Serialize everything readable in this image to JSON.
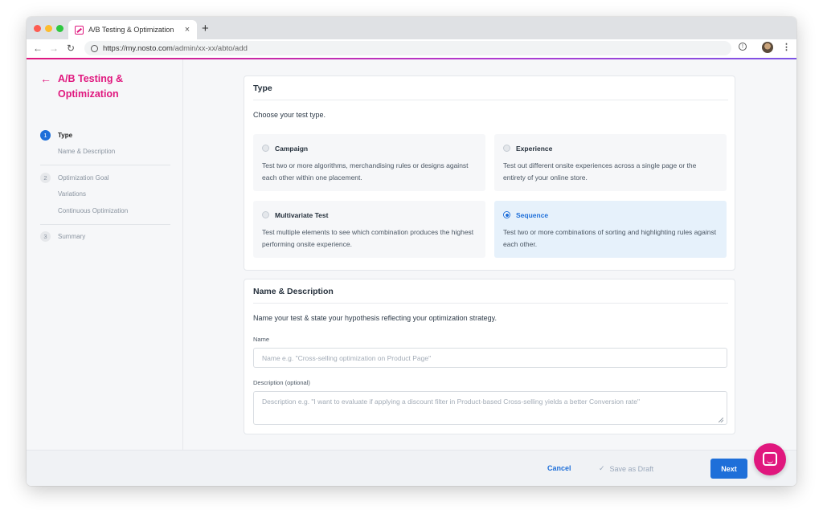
{
  "browser": {
    "tab_title": "A/B Testing & Optimization",
    "tab_close": "×",
    "new_tab": "+",
    "url_host": "https://my.nosto.com",
    "url_path": "/admin/xx-xx/abto/add"
  },
  "sidebar": {
    "title": "A/B Testing & Optimization",
    "steps": [
      {
        "num": "1",
        "label": "Type",
        "substeps": [
          "Name & Description"
        ]
      },
      {
        "num": "2",
        "label": "Optimization Goal",
        "substeps": [
          "Variations",
          "Continuous Optimization"
        ]
      },
      {
        "num": "3",
        "label": "Summary",
        "substeps": []
      }
    ]
  },
  "type_card": {
    "title": "Type",
    "subtitle": "Choose your test type.",
    "options": [
      {
        "title": "Campaign",
        "desc": "Test two or more algorithms, merchandising rules or designs against each other within one placement.",
        "selected": false
      },
      {
        "title": "Experience",
        "desc": "Test out different onsite experiences across a single page or the entirety of your online store.",
        "selected": false
      },
      {
        "title": "Multivariate Test",
        "desc": "Test multiple elements to see which combination produces the highest performing onsite experience.",
        "selected": false
      },
      {
        "title": "Sequence",
        "desc": "Test two or more combinations of sorting and highlighting rules against each other.",
        "selected": true
      }
    ]
  },
  "name_card": {
    "title": "Name & Description",
    "subtitle": "Name your test & state your hypothesis reflecting your optimization strategy.",
    "name_label": "Name",
    "name_value": "",
    "name_placeholder": "Name e.g. \"Cross-selling optimization on Product Page\"",
    "desc_label": "Description (optional)",
    "desc_value": "",
    "desc_placeholder": "Description e.g. \"I want to evaluate if applying a discount filter in Product-based Cross-selling yields a better Conversion rate\""
  },
  "footer": {
    "cancel_label": "Cancel",
    "draft_label": "Save as Draft",
    "next_label": "Next"
  },
  "colors": {
    "brand": "#e0177e",
    "primary": "#1e6fd9",
    "selected_bg": "#e6f1fb"
  },
  "icons": {
    "back": "arrow-left-icon",
    "chat": "chat-icon",
    "check": "check-icon"
  }
}
